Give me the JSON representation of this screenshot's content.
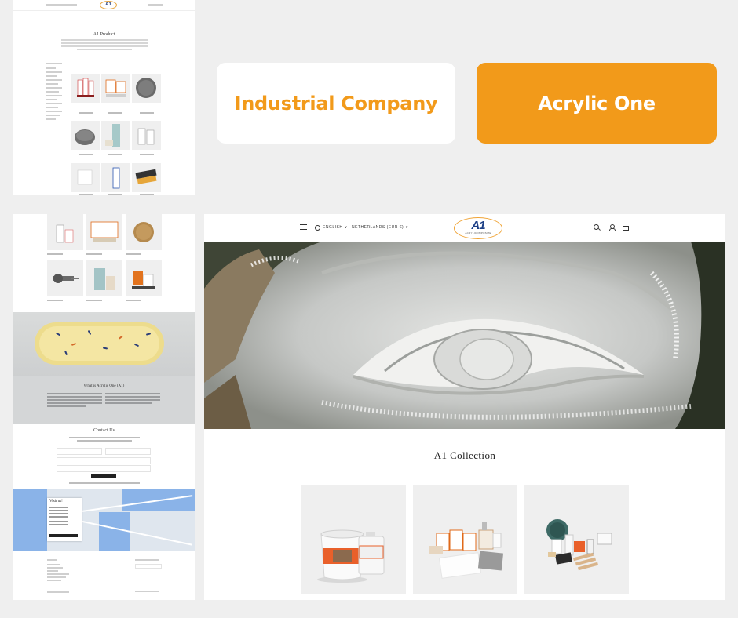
{
  "tags": {
    "industrial": "Industrial Company",
    "acrylic": "Acrylic One"
  },
  "preview_top": {
    "title": "A1 Product",
    "logo_text": "A1"
  },
  "preview_bottom": {
    "about_title": "What is Acrylic One (A1)",
    "contact_title": "Contact Us",
    "visit_title": "Visit us!"
  },
  "site": {
    "language_label": "ENGLISH",
    "region_label": "NETHERLANDS (EUR €)",
    "logo_main": "A1",
    "logo_sub": "ACRYLICOMPOSITE",
    "collection_title": "A1 Collection"
  },
  "colors": {
    "accent": "#f29a1a",
    "brand_blue": "#1c3f86",
    "page_bg": "#efefef"
  },
  "icons": [
    "menu-icon",
    "globe-icon",
    "chevron-down-icon",
    "search-icon",
    "account-icon",
    "cart-icon"
  ]
}
